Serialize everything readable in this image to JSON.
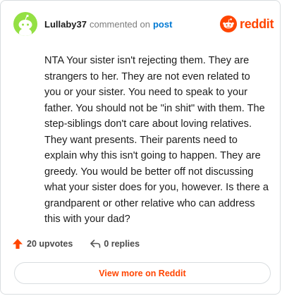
{
  "header": {
    "username": "Lullaby37",
    "action_text": "commented on",
    "post_link": "post",
    "brand": "reddit"
  },
  "comment": {
    "body": "NTA Your sister isn't rejecting them. They are strangers to her. They are not even related to you or your sister. You need to speak to your father. You should not be \"in shit\" with them. The step-siblings don't care about loving relatives. They want presents. Their parents need to explain why this isn't going to happen. They are greedy. You would be better off not discussing what your sister does for you, however. Is there a grandparent or other relative who can address this with your dad?"
  },
  "footer": {
    "upvotes": "20 upvotes",
    "replies": "0 replies"
  },
  "view_more": {
    "label": "View more on Reddit"
  },
  "colors": {
    "accent": "#ff4500",
    "link": "#0079d3",
    "avatar_bg": "#94e044"
  },
  "icons": {
    "avatar": "snoo-avatar-icon",
    "brand": "reddit-logo-icon",
    "upvote": "upvote-arrow-icon",
    "reply": "reply-arrow-icon"
  }
}
